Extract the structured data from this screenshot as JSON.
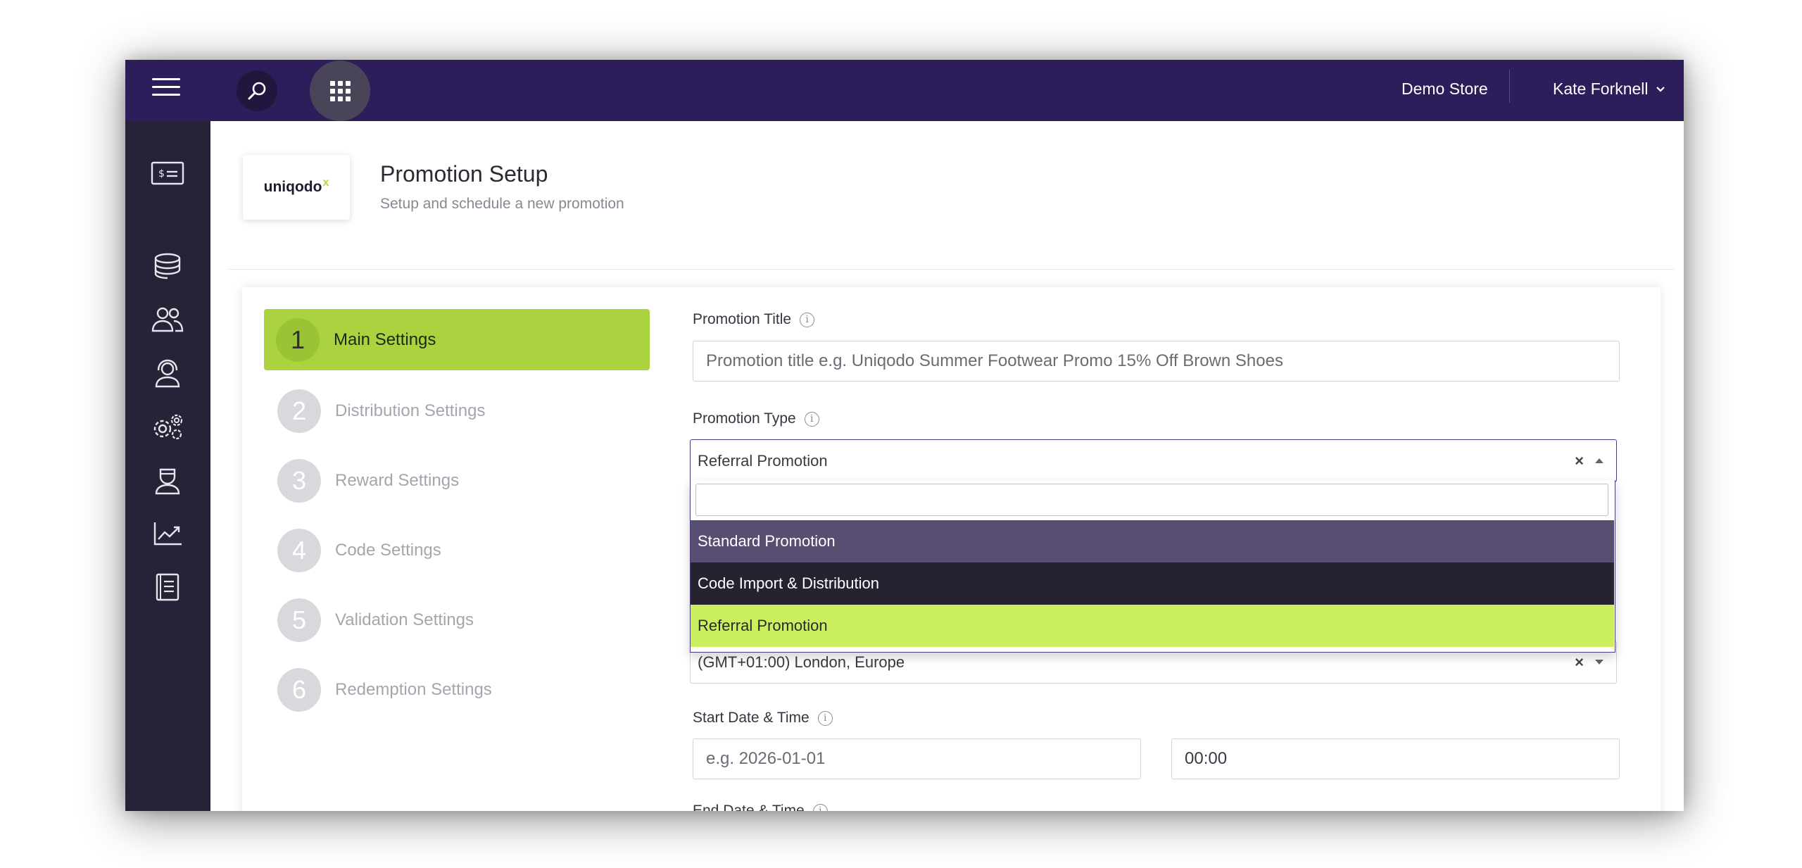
{
  "topbar": {
    "store_name": "Demo Store",
    "user_name": "Kate Forknell"
  },
  "sidebar": {
    "icons": [
      "voucher-icon",
      "coins-icon",
      "users-icon",
      "support-agent-icon",
      "settings-gears-icon",
      "admin-user-icon",
      "analytics-icon",
      "documentation-icon"
    ]
  },
  "header": {
    "logo_text": "uniqodo",
    "logo_mark": "x",
    "title": "Promotion Setup",
    "subtitle": "Setup and schedule a new promotion"
  },
  "steps": [
    {
      "num": "1",
      "label": "Main Settings",
      "active": true
    },
    {
      "num": "2",
      "label": "Distribution Settings",
      "active": false
    },
    {
      "num": "3",
      "label": "Reward Settings",
      "active": false
    },
    {
      "num": "4",
      "label": "Code Settings",
      "active": false
    },
    {
      "num": "5",
      "label": "Validation Settings",
      "active": false
    },
    {
      "num": "6",
      "label": "Redemption Settings",
      "active": false
    }
  ],
  "form": {
    "promotion_title": {
      "label": "Promotion Title",
      "value": "",
      "placeholder": "Promotion title e.g. Uniqodo Summer Footwear Promo 15% Off Brown Shoes"
    },
    "promotion_type": {
      "label": "Promotion Type",
      "selected": "Referral Promotion",
      "clear_symbol": "×",
      "options": [
        "Standard Promotion",
        "Code Import & Distribution",
        "Referral Promotion"
      ],
      "search_value": ""
    },
    "timezone": {
      "selected": "(GMT+01:00) London, Europe",
      "clear_symbol": "×"
    },
    "start": {
      "label": "Start Date & Time",
      "date_placeholder": "e.g. 2026-01-01",
      "time_value": "00:00"
    },
    "end": {
      "label": "End Date & Time"
    }
  },
  "colors": {
    "topbar": "#2d1d5a",
    "sidebar": "#262238",
    "accent_green": "#aad33f",
    "option_highlight": "#cbef5e"
  }
}
